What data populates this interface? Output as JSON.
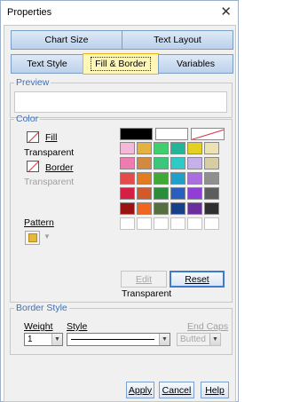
{
  "window": {
    "title": "Properties",
    "close_glyph": "✕"
  },
  "tabs": {
    "row1": [
      "Chart Size",
      "Text Layout"
    ],
    "row2": [
      "Text Style",
      "Fill & Border",
      "Variables"
    ],
    "active": "Fill & Border"
  },
  "preview": {
    "legend": "Preview"
  },
  "color": {
    "legend": "Color",
    "fill_label": "Fill",
    "fill_value": "Transparent",
    "border_label": "Border",
    "border_value": "Transparent",
    "pattern_label": "Pattern",
    "current": "Transparent",
    "edit_label": "Edit",
    "reset_label": "Reset",
    "top_row": [
      "#000000",
      "#ffffff",
      "transparent"
    ],
    "palette": [
      [
        "#f4b9d7",
        "#e6b23f",
        "#3fcf6d",
        "#23b59a",
        "#e4d020",
        "#ece3b2"
      ],
      [
        "#ee7cae",
        "#d38a3e",
        "#3bc779",
        "#2ecac7",
        "#c6b0ea",
        "#d6cda0"
      ],
      [
        "#e44b4b",
        "#e47b1f",
        "#3eaa35",
        "#1ea0c9",
        "#a96ee0",
        "#8f8f8f"
      ],
      [
        "#d61f45",
        "#d2592a",
        "#2b8d3a",
        "#2a5fc0",
        "#8f3fd6",
        "#5d5d5d"
      ],
      [
        "#9b1212",
        "#f1661f",
        "#566f3f",
        "#163f8c",
        "#6a2f9a",
        "#2f2f2f"
      ],
      [
        "",
        "",
        "",
        "",
        "",
        ""
      ]
    ]
  },
  "border_style": {
    "legend": "Border Style",
    "weight_label": "Weight",
    "weight_value": "1",
    "style_label": "Style",
    "endcaps_label": "End Caps",
    "endcaps_value": "Butted"
  },
  "buttons": {
    "apply": "Apply",
    "cancel": "Cancel",
    "help": "Help"
  }
}
